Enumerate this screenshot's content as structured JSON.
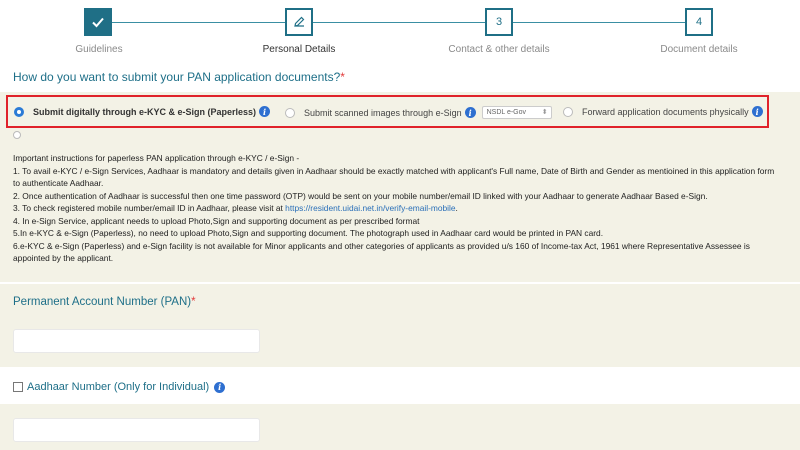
{
  "stepper": {
    "steps": [
      {
        "label": "Guidelines",
        "number": "",
        "state": "done"
      },
      {
        "label": "Personal Details",
        "number": "",
        "state": "current"
      },
      {
        "label": "Contact & other details",
        "number": "3",
        "state": "pending"
      },
      {
        "label": "Document details",
        "number": "4",
        "state": "pending"
      }
    ]
  },
  "question": {
    "text": "How do you want to submit your PAN application documents?",
    "required_mark": "*"
  },
  "options": [
    {
      "label": "Submit digitally through e-KYC & e-Sign (Paperless)",
      "selected": true
    },
    {
      "label": "Submit scanned images through e-Sign",
      "selected": false,
      "select_value": "NSDL e-Gov"
    },
    {
      "label": "Forward application documents physically",
      "selected": false
    }
  ],
  "instructions": {
    "heading": "Important instructions for paperless PAN application through e-KYC / e-Sign -",
    "items": [
      "1. To avail e-KYC / e-Sign Services, Aadhaar is mandatory and details given in Aadhaar should be exactly matched with applicant's Full name, Date of Birth and Gender as mentioined in this application form to authenticate Aadhaar.",
      "2. Once authentication of Aadhaar is successful then one time password (OTP) would be sent on your mobile number/email ID linked with your Aadhaar to generate Aadhaar Based e-Sign.",
      "3. To check registered mobile number/email ID in Aadhaar, please visit at ",
      "4. In e-Sign Service, applicant needs to upload Photo,Sign and supporting document as per prescribed format",
      "5.In e-KYC & e-Sign (Paperless), no need to upload Photo,Sign and supporting document. The photograph used in Aadhaar card would be printed in PAN card.",
      "6.e-KYC & e-Sign (Paperless) and e-Sign facility is not available for Minor applicants and other categories of applicants as provided u/s 160 of Income-tax Act, 1961 where Representative Assessee is appointed by the applicant."
    ],
    "link": "https://resident.uidai.net.in/verify-email-mobile",
    "link_suffix": "."
  },
  "pan": {
    "label": "Permanent Account Number (PAN)",
    "required_mark": "*",
    "value": ""
  },
  "aadhaar": {
    "label": "Aadhaar Number (Only for Individual)",
    "value": ""
  },
  "colors": {
    "accent": "#1f6f86",
    "highlight_border": "#e0222a",
    "info_icon": "#2e6fd0",
    "band": "#f3f2e6"
  }
}
